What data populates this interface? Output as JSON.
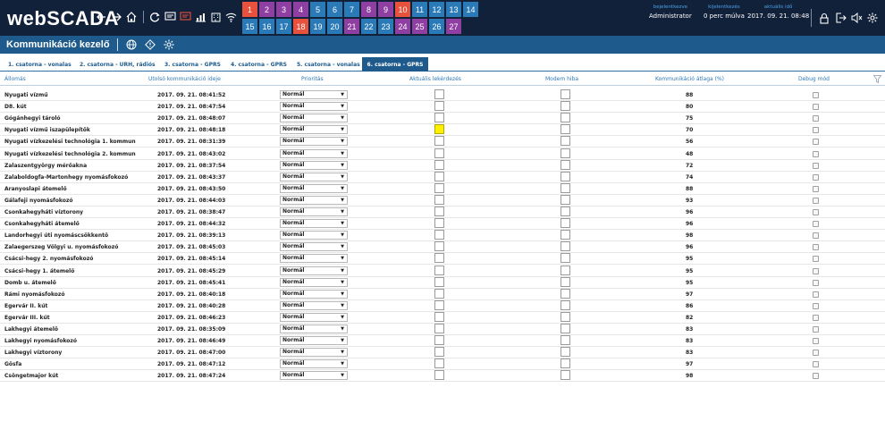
{
  "app": {
    "logo": "webSCADA"
  },
  "header": {
    "logged_in_label": "bejelentkezve",
    "logged_in_user": "Administrator",
    "screen_lock_label": "kijelentkezés",
    "screen_lock_value": "0 perc múlva",
    "time_label": "aktuális idő",
    "time_value": "2017. 09. 21. 08:48"
  },
  "tiles": [
    {
      "label": "1",
      "color": "#e8513c"
    },
    {
      "label": "2",
      "color": "#8e3fa1"
    },
    {
      "label": "3",
      "color": "#8e3fa1"
    },
    {
      "label": "4",
      "color": "#8e3fa1"
    },
    {
      "label": "5",
      "color": "#2a7ab8"
    },
    {
      "label": "6",
      "color": "#2a7ab8"
    },
    {
      "label": "7",
      "color": "#2a7ab8"
    },
    {
      "label": "8",
      "color": "#8e3fa1"
    },
    {
      "label": "9",
      "color": "#8e3fa1"
    },
    {
      "label": "10",
      "color": "#e8513c"
    },
    {
      "label": "11",
      "color": "#2a7ab8"
    },
    {
      "label": "12",
      "color": "#2a7ab8"
    },
    {
      "label": "13",
      "color": "#2a7ab8"
    },
    {
      "label": "14",
      "color": "#2a7ab8"
    },
    {
      "label": "15",
      "color": "#2a7ab8"
    },
    {
      "label": "16",
      "color": "#2a7ab8"
    },
    {
      "label": "17",
      "color": "#2a7ab8"
    },
    {
      "label": "18",
      "color": "#e8513c"
    },
    {
      "label": "19",
      "color": "#2a7ab8"
    },
    {
      "label": "20",
      "color": "#2a7ab8"
    },
    {
      "label": "21",
      "color": "#8e3fa1"
    },
    {
      "label": "22",
      "color": "#2a7ab8"
    },
    {
      "label": "23",
      "color": "#2a7ab8"
    },
    {
      "label": "24",
      "color": "#8e3fa1"
    },
    {
      "label": "25",
      "color": "#8e3fa1"
    },
    {
      "label": "26",
      "color": "#2a7ab8"
    },
    {
      "label": "27",
      "color": "#8e3fa1"
    }
  ],
  "page": {
    "title": "Kommunikáció kezelő"
  },
  "tabs": [
    {
      "label": "1. csatorna - vonalas",
      "active": false
    },
    {
      "label": "2. csatorna - URH, rádiós",
      "active": false
    },
    {
      "label": "3. csatorna - GPRS",
      "active": false
    },
    {
      "label": "4. csatorna - GPRS",
      "active": false
    },
    {
      "label": "5. csatorna - vonalas",
      "active": false
    },
    {
      "label": "6. csatorna - GPRS",
      "active": true
    }
  ],
  "table": {
    "headers": {
      "station": "Állomás",
      "last_comm": "Utolsó kommunikáció ideje",
      "priority": "Prioritás",
      "current_query": "Aktuális lekérdezés",
      "modem_error": "Modem hiba",
      "comm_avg": "Kommunikáció átlaga (%)",
      "debug": "Debug mód"
    },
    "rows": [
      {
        "station": "Nyugati vízmű",
        "time": "2017. 09. 21. 08:41:52",
        "priority": "Normál",
        "avg": "88",
        "query": false
      },
      {
        "station": "D8. kút",
        "time": "2017. 09. 21. 08:47:54",
        "priority": "Normál",
        "avg": "80",
        "query": false
      },
      {
        "station": "Gógánhegyi tároló",
        "time": "2017. 09. 21. 08:48:07",
        "priority": "Normál",
        "avg": "75",
        "query": false
      },
      {
        "station": "Nyugati vízmű iszapülepítők",
        "time": "2017. 09. 21. 08:48:18",
        "priority": "Normál",
        "avg": "70",
        "query": true
      },
      {
        "station": "Nyugati vízkezelési technológia 1. kommun",
        "time": "2017. 09. 21. 08:31:39",
        "priority": "Normál",
        "avg": "56",
        "query": false
      },
      {
        "station": "Nyugati vízkezelési technológia 2. kommun",
        "time": "2017. 09. 21. 08:43:02",
        "priority": "Normál",
        "avg": "48",
        "query": false
      },
      {
        "station": "Zalaszentgyörgy mérőakna",
        "time": "2017. 09. 21. 08:37:54",
        "priority": "Normál",
        "avg": "72",
        "query": false
      },
      {
        "station": "Zalaboldogfa-Martonhegy nyomásfokozó",
        "time": "2017. 09. 21. 08:43:37",
        "priority": "Normál",
        "avg": "74",
        "query": false
      },
      {
        "station": "Aranyoslapi átemelő",
        "time": "2017. 09. 21. 08:43:50",
        "priority": "Normál",
        "avg": "88",
        "query": false
      },
      {
        "station": "Gálafeji nyomásfokozó",
        "time": "2017. 09. 21. 08:44:03",
        "priority": "Normál",
        "avg": "93",
        "query": false
      },
      {
        "station": "Csonkahegyháti víztorony",
        "time": "2017. 09. 21. 08:38:47",
        "priority": "Normál",
        "avg": "96",
        "query": false
      },
      {
        "station": "Csonkahegyháti átemelő",
        "time": "2017. 09. 21. 08:44:32",
        "priority": "Normál",
        "avg": "96",
        "query": false
      },
      {
        "station": "Landorhegyi úti nyomáscsökkentő",
        "time": "2017. 09. 21. 08:39:13",
        "priority": "Normál",
        "avg": "98",
        "query": false
      },
      {
        "station": "Zalaegerszeg Völgyi u. nyomásfokozó",
        "time": "2017. 09. 21. 08:45:03",
        "priority": "Normál",
        "avg": "96",
        "query": false
      },
      {
        "station": "Csácsi-hegy 2. nyomásfokozó",
        "time": "2017. 09. 21. 08:45:14",
        "priority": "Normál",
        "avg": "95",
        "query": false
      },
      {
        "station": "Csácsi-hegy 1. átemelő",
        "time": "2017. 09. 21. 08:45:29",
        "priority": "Normál",
        "avg": "95",
        "query": false
      },
      {
        "station": "Domb u. átemelő",
        "time": "2017. 09. 21. 08:45:41",
        "priority": "Normál",
        "avg": "95",
        "query": false
      },
      {
        "station": "Rámi nyomásfokozó",
        "time": "2017. 09. 21. 08:40:18",
        "priority": "Normál",
        "avg": "97",
        "query": false
      },
      {
        "station": "Egervár II. kút",
        "time": "2017. 09. 21. 08:40:28",
        "priority": "Normál",
        "avg": "86",
        "query": false
      },
      {
        "station": "Egervár III. kút",
        "time": "2017. 09. 21. 08:46:23",
        "priority": "Normál",
        "avg": "82",
        "query": false
      },
      {
        "station": "Lakhegyi átemelő",
        "time": "2017. 09. 21. 08:35:09",
        "priority": "Normál",
        "avg": "83",
        "query": false
      },
      {
        "station": "Lakhegyi nyomásfokozó",
        "time": "2017. 09. 21. 08:46:49",
        "priority": "Normál",
        "avg": "83",
        "query": false
      },
      {
        "station": "Lakhegyi víztorony",
        "time": "2017. 09. 21. 08:47:00",
        "priority": "Normál",
        "avg": "83",
        "query": false
      },
      {
        "station": "Gősfa",
        "time": "2017. 09. 21. 08:47:12",
        "priority": "Normál",
        "avg": "97",
        "query": false
      },
      {
        "station": "Csöngetmajor kút",
        "time": "2017. 09. 21. 08:47:24",
        "priority": "Normál",
        "avg": "98",
        "query": false
      }
    ]
  }
}
